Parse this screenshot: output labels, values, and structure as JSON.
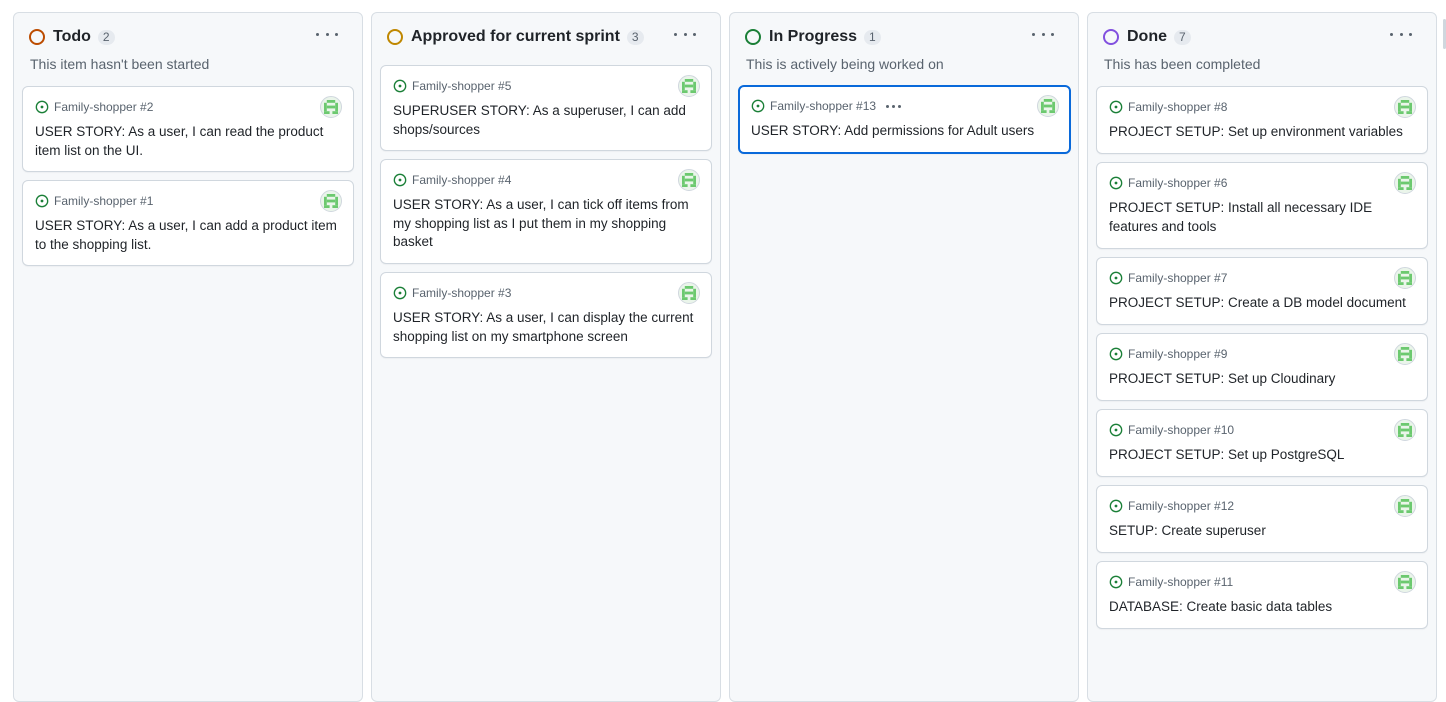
{
  "columns": [
    {
      "title": "Todo",
      "count": "2",
      "description": "This item hasn't been started",
      "status_color": "#bc4c00",
      "cards": [
        {
          "ref": "Family-shopper #2",
          "title": "USER STORY: As a user, I can read the product item list on the UI.",
          "avatar_icon": "identicon-avatar-icon"
        },
        {
          "ref": "Family-shopper #1",
          "title": "USER STORY: As a user, I can add a product item to the shopping list.",
          "avatar_icon": "identicon-avatar-icon"
        }
      ]
    },
    {
      "title": "Approved for current sprint",
      "count": "3",
      "description": "",
      "status_color": "#bf8700",
      "cards": [
        {
          "ref": "Family-shopper #5",
          "title": "SUPERUSER STORY: As a superuser, I can add shops/sources",
          "avatar_icon": "identicon-avatar-icon"
        },
        {
          "ref": "Family-shopper #4",
          "title": "USER STORY: As a user, I can tick off items from my shopping list as I put them in my shopping basket",
          "avatar_icon": "identicon-avatar-icon"
        },
        {
          "ref": "Family-shopper #3",
          "title": "USER STORY: As a user, I can display the current shopping list on my smartphone screen",
          "avatar_icon": "identicon-avatar-icon"
        }
      ]
    },
    {
      "title": "In Progress",
      "count": "1",
      "description": "This is actively being worked on",
      "status_color": "#1a7f37",
      "cards": [
        {
          "ref": "Family-shopper #13",
          "title": "USER STORY: Add permissions for Adult users",
          "avatar_icon": "identicon-avatar-icon",
          "selected": true
        }
      ]
    },
    {
      "title": "Done",
      "count": "7",
      "description": "This has been completed",
      "status_color": "#8250df",
      "cards": [
        {
          "ref": "Family-shopper #8",
          "title": "PROJECT SETUP: Set up environment variables",
          "avatar_icon": "identicon-avatar-icon"
        },
        {
          "ref": "Family-shopper #6",
          "title": "PROJECT SETUP: Install all necessary IDE features and tools",
          "avatar_icon": "identicon-avatar-icon"
        },
        {
          "ref": "Family-shopper #7",
          "title": "PROJECT SETUP: Create a DB model document",
          "avatar_icon": "identicon-avatar-icon"
        },
        {
          "ref": "Family-shopper #9",
          "title": "PROJECT SETUP: Set up Cloudinary",
          "avatar_icon": "identicon-avatar-icon"
        },
        {
          "ref": "Family-shopper #10",
          "title": "PROJECT SETUP: Set up PostgreSQL",
          "avatar_icon": "identicon-avatar-icon"
        },
        {
          "ref": "Family-shopper #12",
          "title": "SETUP: Create superuser",
          "avatar_icon": "identicon-avatar-icon"
        },
        {
          "ref": "Family-shopper #11",
          "title": "DATABASE: Create basic data tables",
          "avatar_icon": "identicon-avatar-icon"
        }
      ]
    }
  ],
  "icons": {
    "issue_open": "issue-opened-icon",
    "menu": "kebab-horizontal-icon"
  },
  "colors": {
    "issue_open": "#1a7f37",
    "selected_border": "#0969da"
  }
}
